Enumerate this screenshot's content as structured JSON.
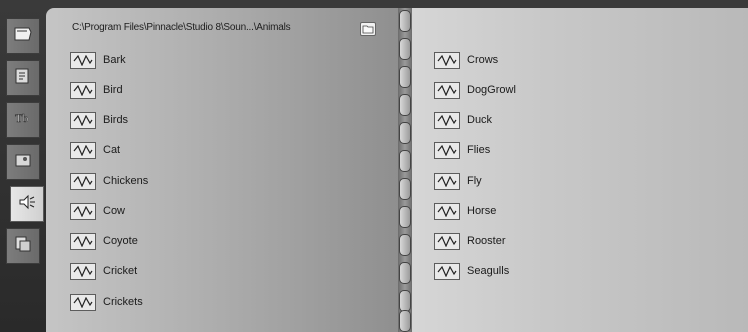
{
  "browser": {
    "path": "C:\\Program Files\\Pinnacle\\Studio 8\\Soun...\\Animals"
  },
  "tabs": [
    {
      "name": "video-tab",
      "icon": "film-icon",
      "active": false
    },
    {
      "name": "transitions-tab",
      "icon": "transition-icon",
      "active": false
    },
    {
      "name": "titles-tab",
      "icon": "title-icon",
      "active": false
    },
    {
      "name": "photos-tab",
      "icon": "photo-icon",
      "active": false
    },
    {
      "name": "sound-effects-tab",
      "icon": "speaker-icon",
      "active": true
    },
    {
      "name": "menus-tab",
      "icon": "disc-menu-icon",
      "active": false
    }
  ],
  "left_page": {
    "items": [
      "Bark",
      "Bird",
      "Birds",
      "Cat",
      "Chickens",
      "Cow",
      "Coyote",
      "Cricket",
      "Crickets"
    ]
  },
  "right_page": {
    "items": [
      "Crows",
      "DogGrowl",
      "Duck",
      "Flies",
      "Fly",
      "Horse",
      "Rooster",
      "Seagulls"
    ]
  }
}
